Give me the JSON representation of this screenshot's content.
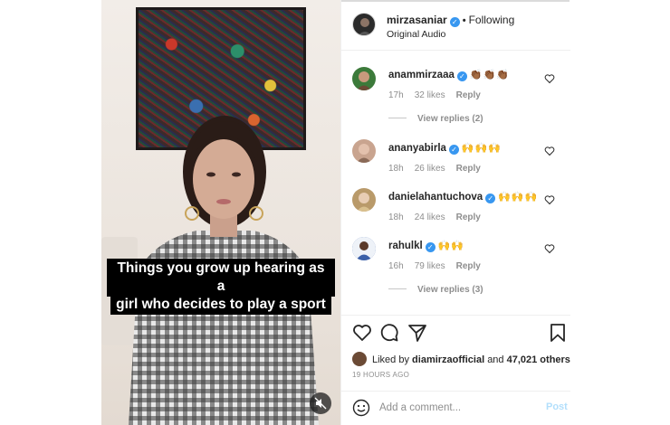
{
  "post": {
    "username": "mirzasaniar",
    "follow_status": "Following",
    "audio": "Original Audio",
    "caption_line_1": "Things you grow up hearing as a",
    "caption_line_2": "girl who decides to play a sport"
  },
  "comments": [
    {
      "username": "anammirzaaa",
      "emoji": "👏🏾👏🏾👏🏾",
      "time": "17h",
      "likes": "32 likes",
      "reply": "Reply",
      "view_replies": "View replies (2)",
      "avatar_color": "#3c7a3a"
    },
    {
      "username": "ananyabirla",
      "emoji": "🙌🙌🙌",
      "time": "18h",
      "likes": "26 likes",
      "reply": "Reply",
      "avatar_color": "#c9a48f"
    },
    {
      "username": "danielahantuchova",
      "emoji": "🙌🙌🙌",
      "time": "18h",
      "likes": "24 likes",
      "reply": "Reply",
      "avatar_color": "#b99a6a"
    },
    {
      "username": "rahulkl",
      "emoji": "🙌🙌",
      "time": "16h",
      "likes": "79 likes",
      "reply": "Reply",
      "view_replies": "View replies (3)",
      "avatar_color": "#3a5fa8"
    }
  ],
  "likes": {
    "prefix": "Liked by",
    "user": "diamirzaofficial",
    "joiner": "and",
    "others": "47,021 others",
    "timestamp": "19 HOURS AGO"
  },
  "add_comment": {
    "placeholder": "Add a comment...",
    "post_label": "Post"
  },
  "icons": {
    "heart": "heart-icon",
    "comment": "comment-icon",
    "share": "share-icon",
    "save": "bookmark-icon",
    "emoji": "smile-icon",
    "mute": "muted-speaker-icon"
  },
  "colors": {
    "verified": "#3897f0",
    "post_disabled": "#b2dffc",
    "muted_text": "#8e8e8e"
  }
}
